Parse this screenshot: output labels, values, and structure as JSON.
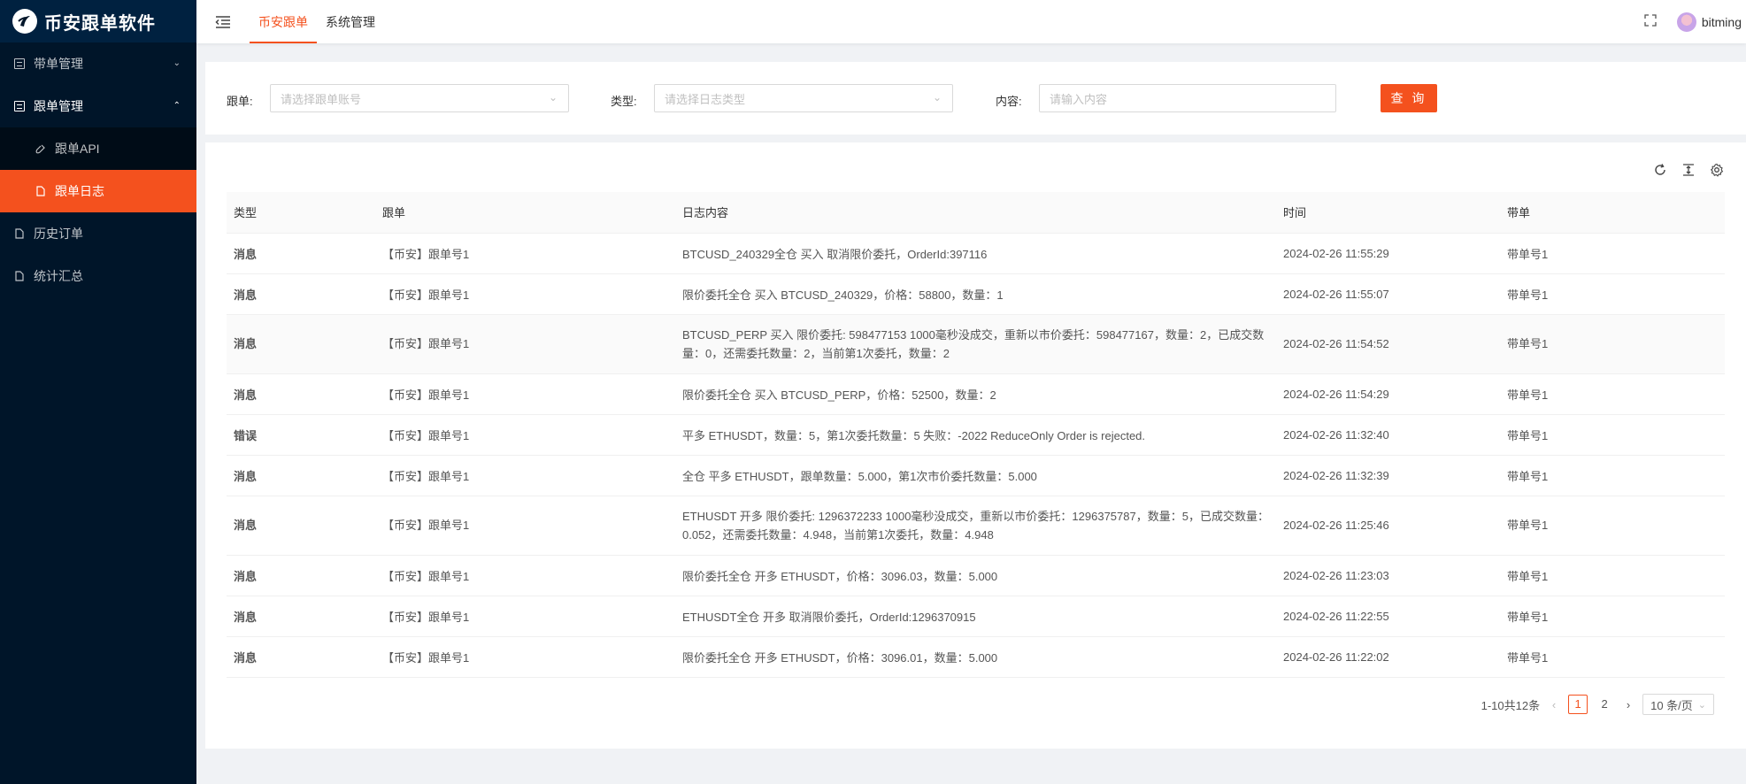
{
  "app": {
    "title": "币安跟单软件"
  },
  "sidebar": {
    "items": [
      {
        "label": "带单管理",
        "arrow": "⌄"
      },
      {
        "label": "跟单管理",
        "arrow": "⌃"
      },
      {
        "label": "跟单API"
      },
      {
        "label": "跟单日志"
      },
      {
        "label": "历史订单"
      },
      {
        "label": "统计汇总"
      }
    ]
  },
  "header": {
    "tabs": [
      {
        "label": "币安跟单"
      },
      {
        "label": "系统管理"
      }
    ],
    "username": "bitming"
  },
  "search": {
    "follow_label": "跟单:",
    "follow_placeholder": "请选择跟单账号",
    "type_label": "类型:",
    "type_placeholder": "请选择日志类型",
    "content_label": "内容:",
    "content_placeholder": "请输入内容",
    "query_button": "查 询"
  },
  "table": {
    "columns": [
      "类型",
      "跟单",
      "日志内容",
      "时间",
      "带单"
    ],
    "rows": [
      {
        "type": "消息",
        "follow": "【币安】跟单号1",
        "content": "BTCUSD_240329全仓 买入 取消限价委托，OrderId:397116",
        "time": "2024-02-26 11:55:29",
        "lead": "带单号1"
      },
      {
        "type": "消息",
        "follow": "【币安】跟单号1",
        "content": "限价委托全仓 买入 BTCUSD_240329，价格：58800，数量：1",
        "time": "2024-02-26 11:55:07",
        "lead": "带单号1"
      },
      {
        "type": "消息",
        "follow": "【币安】跟单号1",
        "content": "BTCUSD_PERP 买入 限价委托: 598477153 1000毫秒没成交，重新以市价委托：598477167，数量：2，已成交数量：0，还需委托数量：2，当前第1次委托，数量：2",
        "time": "2024-02-26 11:54:52",
        "lead": "带单号1"
      },
      {
        "type": "消息",
        "follow": "【币安】跟单号1",
        "content": "限价委托全仓 买入 BTCUSD_PERP，价格：52500，数量：2",
        "time": "2024-02-26 11:54:29",
        "lead": "带单号1"
      },
      {
        "type": "错误",
        "follow": "【币安】跟单号1",
        "content": "平多 ETHUSDT，数量：5，第1次委托数量：5 失败：-2022 ReduceOnly Order is rejected.",
        "time": "2024-02-26 11:32:40",
        "lead": "带单号1"
      },
      {
        "type": "消息",
        "follow": "【币安】跟单号1",
        "content": "全仓 平多 ETHUSDT，跟单数量：5.000，第1次市价委托数量：5.000",
        "time": "2024-02-26 11:32:39",
        "lead": "带单号1"
      },
      {
        "type": "消息",
        "follow": "【币安】跟单号1",
        "content": "ETHUSDT 开多 限价委托: 1296372233 1000毫秒没成交，重新以市价委托：1296375787，数量：5，已成交数量：0.052，还需委托数量：4.948，当前第1次委托，数量：4.948",
        "time": "2024-02-26 11:25:46",
        "lead": "带单号1"
      },
      {
        "type": "消息",
        "follow": "【币安】跟单号1",
        "content": "限价委托全仓 开多 ETHUSDT，价格：3096.03，数量：5.000",
        "time": "2024-02-26 11:23:03",
        "lead": "带单号1"
      },
      {
        "type": "消息",
        "follow": "【币安】跟单号1",
        "content": "ETHUSDT全仓 开多 取消限价委托，OrderId:1296370915",
        "time": "2024-02-26 11:22:55",
        "lead": "带单号1"
      },
      {
        "type": "消息",
        "follow": "【币安】跟单号1",
        "content": "限价委托全仓 开多 ETHUSDT，价格：3096.01，数量：5.000",
        "time": "2024-02-26 11:22:02",
        "lead": "带单号1"
      }
    ]
  },
  "pagination": {
    "summary": "1-10共12条",
    "pages": [
      "1",
      "2"
    ],
    "current": "1",
    "page_size": "10 条/页"
  },
  "colors": {
    "accent": "#f4511e",
    "sidebar_bg": "#001529",
    "message": "#389e0d",
    "error": "#cf1322"
  }
}
